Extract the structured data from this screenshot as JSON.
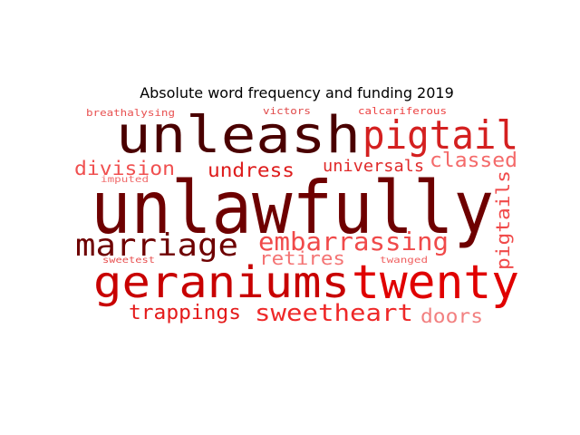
{
  "chart_data": {
    "type": "wordcloud",
    "title": "Absolute word frequency and funding 2019",
    "words": [
      {
        "text": "unlawfully",
        "color": "#6e0000"
      },
      {
        "text": "unleash",
        "color": "#4a0000"
      },
      {
        "text": "pigtail",
        "color": "#d42020"
      },
      {
        "text": "geraniums",
        "color": "#c80000"
      },
      {
        "text": "twenty",
        "color": "#e00000"
      },
      {
        "text": "marriage",
        "color": "#6e0000"
      },
      {
        "text": "embarrassing",
        "color": "#f04a4a"
      },
      {
        "text": "sweetheart",
        "color": "#ee2828"
      },
      {
        "text": "trappings",
        "color": "#e41a1a"
      },
      {
        "text": "division",
        "color": "#f05050"
      },
      {
        "text": "undress",
        "color": "#de1c1c"
      },
      {
        "text": "universals",
        "color": "#e02a2a"
      },
      {
        "text": "classed",
        "color": "#f46a6a"
      },
      {
        "text": "pigtails",
        "color": "#f04a4a"
      },
      {
        "text": "retires",
        "color": "#f47474"
      },
      {
        "text": "doors",
        "color": "#f28080"
      },
      {
        "text": "breathalysing",
        "color": "#e85050"
      },
      {
        "text": "victors",
        "color": "#e04848"
      },
      {
        "text": "calcariferous",
        "color": "#ec4040"
      },
      {
        "text": "imputed",
        "color": "#f06a6a"
      },
      {
        "text": "sweetest",
        "color": "#e85050"
      },
      {
        "text": "twanged",
        "color": "#f06060"
      }
    ]
  }
}
